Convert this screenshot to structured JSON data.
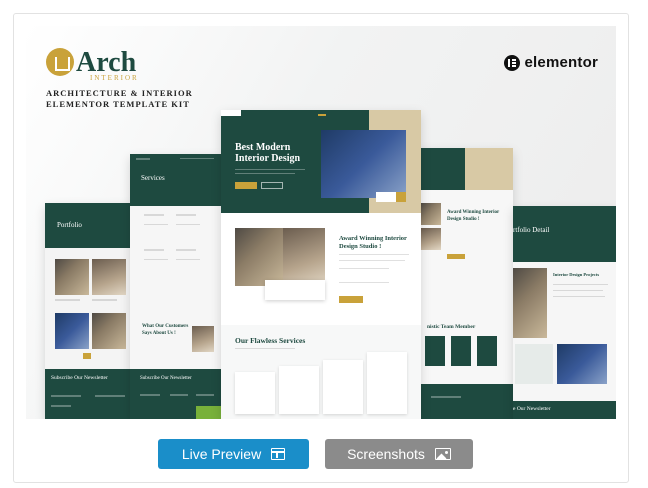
{
  "banner": {
    "logo_text": "Arch",
    "logo_sub": "INTERIOR",
    "tagline_line1": "ARCHITECTURE & INTERIOR",
    "tagline_line2": "ELEMENTOR TEMPLATE KIT",
    "partner": "elementor"
  },
  "mockups": {
    "center_hero_title_1": "Best Modern",
    "center_hero_title_2": "Interior Design",
    "center_award_1": "Award Winning Interior",
    "center_award_2": "Design Studio !",
    "center_services": "Our Flawless Services",
    "services_title": "Services",
    "portfolio_title": "Portfolio",
    "customers_1": "What Our Customers",
    "customers_2": "Says About Us !",
    "newsletter": "Subscribe Our Newsletter",
    "newsletter_2": "Subscribe Our Newsletter",
    "right_award_1": "Award Winning Interior",
    "right_award_2": "Design Studio !",
    "right_team": "nistic Team Member",
    "portfolio_detail": "rtfolio Detail",
    "interior_projects": "Interior Design Projects",
    "right_newsletter": "e Our Newsletter"
  },
  "actions": {
    "live_preview": "Live Preview",
    "screenshots": "Screenshots"
  },
  "colors": {
    "brand_green": "#1e4a40",
    "brand_gold": "#c9a23a",
    "live_button": "#1a8ec9",
    "screenshots_button": "#8b8b8b"
  }
}
